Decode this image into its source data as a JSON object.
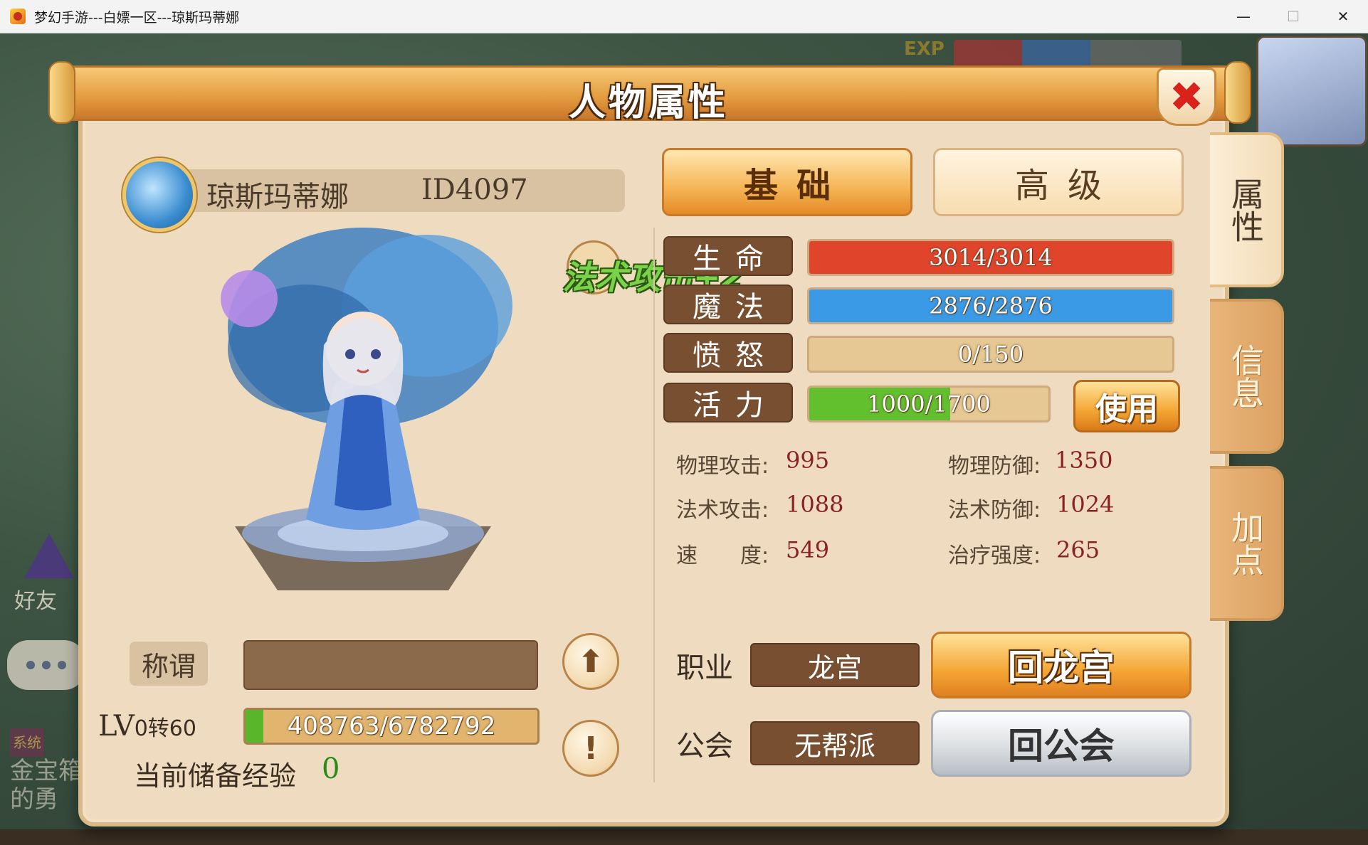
{
  "window": {
    "title": "梦幻手游---白嫖一区---琼斯玛蒂娜",
    "min_glyph": "—",
    "max_glyph": "☐",
    "close_glyph": "✕"
  },
  "background": {
    "exp_label": "EXP",
    "friend_label": "好友",
    "system_badge": "系统",
    "system_text": "金宝箱的勇"
  },
  "dialog": {
    "title": "人物属性",
    "close_glyph": "✖"
  },
  "character": {
    "name": "琼斯玛蒂娜",
    "id": "ID4097",
    "title_label": "称谓",
    "title_value": "",
    "level_prefix": "LV",
    "level_sub": "0转60",
    "exp_current": 408763,
    "exp_max": 6782792,
    "exp_text": "408763/6782792",
    "reserve_label": "当前储备经验",
    "reserve_value": "0",
    "upload_glyph": "⬆",
    "info_glyph": "!"
  },
  "tabs": {
    "basic": "基础",
    "advanced": "高级"
  },
  "floating_text": "法术攻击+2",
  "stats": {
    "hp": {
      "label": "生命",
      "text": "3014/3014",
      "current": 3014,
      "max": 3014,
      "color": "#e0452c"
    },
    "mp": {
      "label": "魔法",
      "text": "2876/2876",
      "current": 2876,
      "max": 2876,
      "color": "#3a9ae6"
    },
    "anger": {
      "label": "愤怒",
      "text": "0/150",
      "current": 0,
      "max": 150,
      "color": "#e0a040"
    },
    "vitality": {
      "label": "活力",
      "text": "1000/1700",
      "current": 1000,
      "max": 1700,
      "color": "#62bf2e"
    },
    "use_button": "使用"
  },
  "attributes": [
    {
      "label": "物理攻击:",
      "value": "995"
    },
    {
      "label": "物理防御:",
      "value": "1350"
    },
    {
      "label": "法术攻击:",
      "value": "1088"
    },
    {
      "label": "法术防御:",
      "value": "1024"
    },
    {
      "label": "速　　度:",
      "value": "549"
    },
    {
      "label": "治疗强度:",
      "value": "265"
    }
  ],
  "job": {
    "label": "职业",
    "value": "龙宫",
    "button": "回龙宫"
  },
  "guild": {
    "label": "公会",
    "value": "无帮派",
    "button": "回公会"
  },
  "side_tabs": {
    "attributes": "属性",
    "info": "信息",
    "add_points": "加点"
  }
}
